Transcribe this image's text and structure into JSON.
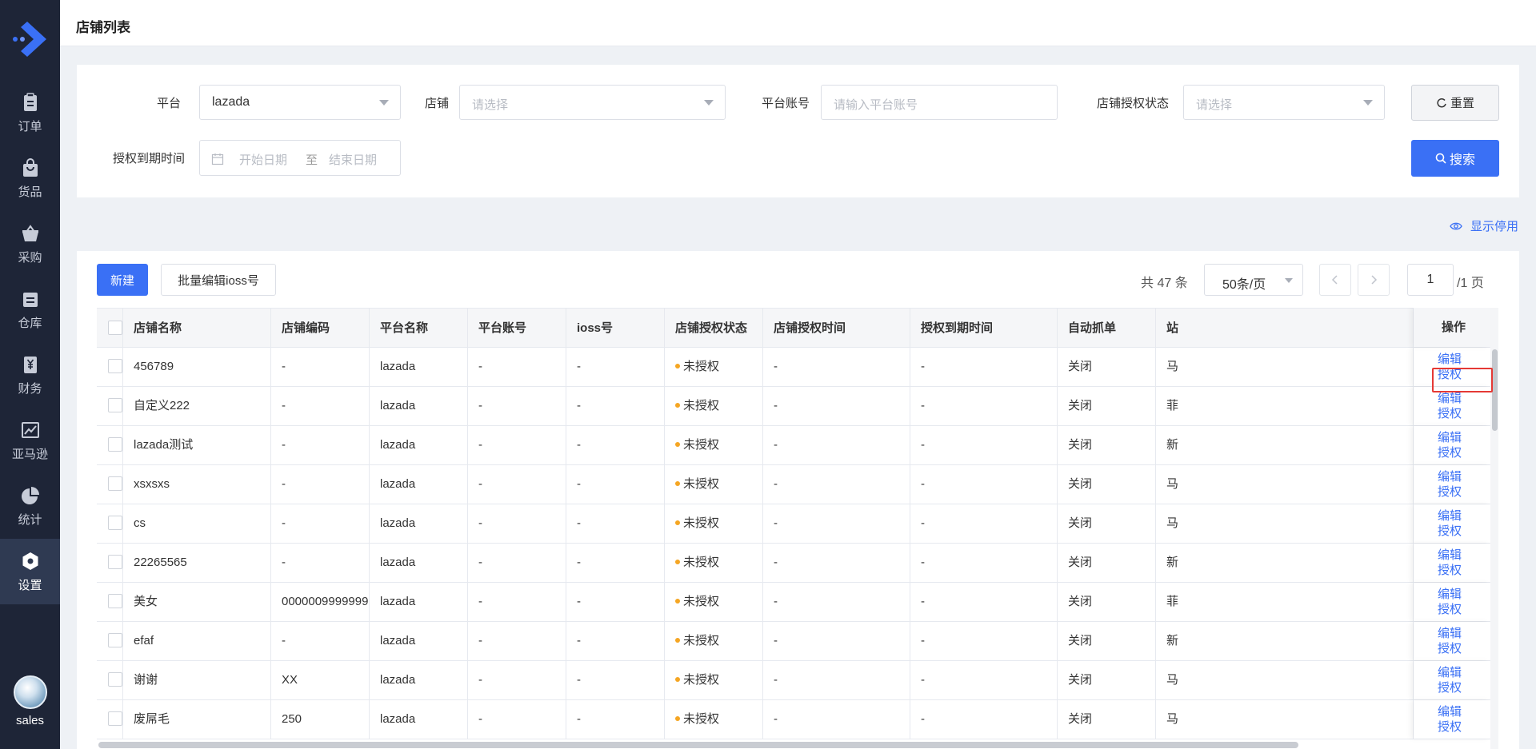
{
  "app": {
    "user_name": "sales"
  },
  "nav": [
    {
      "label": "订单",
      "icon": "clipboard-icon",
      "active": false
    },
    {
      "label": "货品",
      "icon": "shopping-bag-icon",
      "active": false
    },
    {
      "label": "采购",
      "icon": "basket-icon",
      "active": false
    },
    {
      "label": "仓库",
      "icon": "warehouse-icon",
      "active": false
    },
    {
      "label": "财务",
      "icon": "yuan-icon",
      "active": false
    },
    {
      "label": "亚马逊",
      "icon": "chart-line-icon",
      "active": false
    },
    {
      "label": "统计",
      "icon": "pie-chart-icon",
      "active": false
    },
    {
      "label": "设置",
      "icon": "hexagon-settings-icon",
      "active": true
    }
  ],
  "header": {
    "title": "店铺列表"
  },
  "filters": {
    "platform_label": "平台",
    "platform_value": "lazada",
    "shop_label": "店铺",
    "shop_placeholder": "请选择",
    "account_label": "平台账号",
    "account_placeholder": "请输入平台账号",
    "auth_status_label": "店铺授权状态",
    "auth_status_placeholder": "请选择",
    "expire_label": "授权到期时间",
    "start_placeholder": "开始日期",
    "range_sep": "至",
    "end_placeholder": "结束日期",
    "reset_label": "重置",
    "search_label": "搜索"
  },
  "show_disabled_label": "显示停用",
  "toolbar": {
    "new_label": "新建",
    "batch_label": "批量编辑ioss号",
    "total_text": "共 47 条",
    "page_size": "50条/页",
    "current_page": "1",
    "total_pages": "/1 页"
  },
  "table": {
    "columns": [
      "店铺名称",
      "店铺编码",
      "平台名称",
      "平台账号",
      "ioss号",
      "店铺授权状态",
      "店铺授权时间",
      "授权到期时间",
      "自动抓单",
      "站",
      "操作"
    ],
    "edit_label": "编辑",
    "auth_label": "授权",
    "rows": [
      {
        "name": "456789",
        "code": "-",
        "platform": "lazada",
        "account": "-",
        "ioss": "-",
        "status": "未授权",
        "auth_time": "-",
        "expire_time": "-",
        "auto": "关闭",
        "site": "马"
      },
      {
        "name": "自定义222",
        "code": "-",
        "platform": "lazada",
        "account": "-",
        "ioss": "-",
        "status": "未授权",
        "auth_time": "-",
        "expire_time": "-",
        "auto": "关闭",
        "site": "菲"
      },
      {
        "name": "lazada测试",
        "code": "-",
        "platform": "lazada",
        "account": "-",
        "ioss": "-",
        "status": "未授权",
        "auth_time": "-",
        "expire_time": "-",
        "auto": "关闭",
        "site": "新"
      },
      {
        "name": "xsxsxs",
        "code": "-",
        "platform": "lazada",
        "account": "-",
        "ioss": "-",
        "status": "未授权",
        "auth_time": "-",
        "expire_time": "-",
        "auto": "关闭",
        "site": "马"
      },
      {
        "name": "cs",
        "code": "-",
        "platform": "lazada",
        "account": "-",
        "ioss": "-",
        "status": "未授权",
        "auth_time": "-",
        "expire_time": "-",
        "auto": "关闭",
        "site": "马"
      },
      {
        "name": "22265565",
        "code": "-",
        "platform": "lazada",
        "account": "-",
        "ioss": "-",
        "status": "未授权",
        "auth_time": "-",
        "expire_time": "-",
        "auto": "关闭",
        "site": "新"
      },
      {
        "name": "美女",
        "code": "0000009999999",
        "platform": "lazada",
        "account": "-",
        "ioss": "-",
        "status": "未授权",
        "auth_time": "-",
        "expire_time": "-",
        "auto": "关闭",
        "site": "菲"
      },
      {
        "name": "efaf",
        "code": "-",
        "platform": "lazada",
        "account": "-",
        "ioss": "-",
        "status": "未授权",
        "auth_time": "-",
        "expire_time": "-",
        "auto": "关闭",
        "site": "新"
      },
      {
        "name": "谢谢",
        "code": "XX",
        "platform": "lazada",
        "account": "-",
        "ioss": "-",
        "status": "未授权",
        "auth_time": "-",
        "expire_time": "-",
        "auto": "关闭",
        "site": "马"
      },
      {
        "name": "废屌毛",
        "code": "250",
        "platform": "lazada",
        "account": "-",
        "ioss": "-",
        "status": "未授权",
        "auth_time": "-",
        "expire_time": "-",
        "auto": "关闭",
        "site": "马"
      }
    ]
  },
  "colors": {
    "sidebar_bg": "#1e2537",
    "primary": "#3a70f5",
    "status_dot": "#f5a623",
    "highlight": "#e53935"
  }
}
